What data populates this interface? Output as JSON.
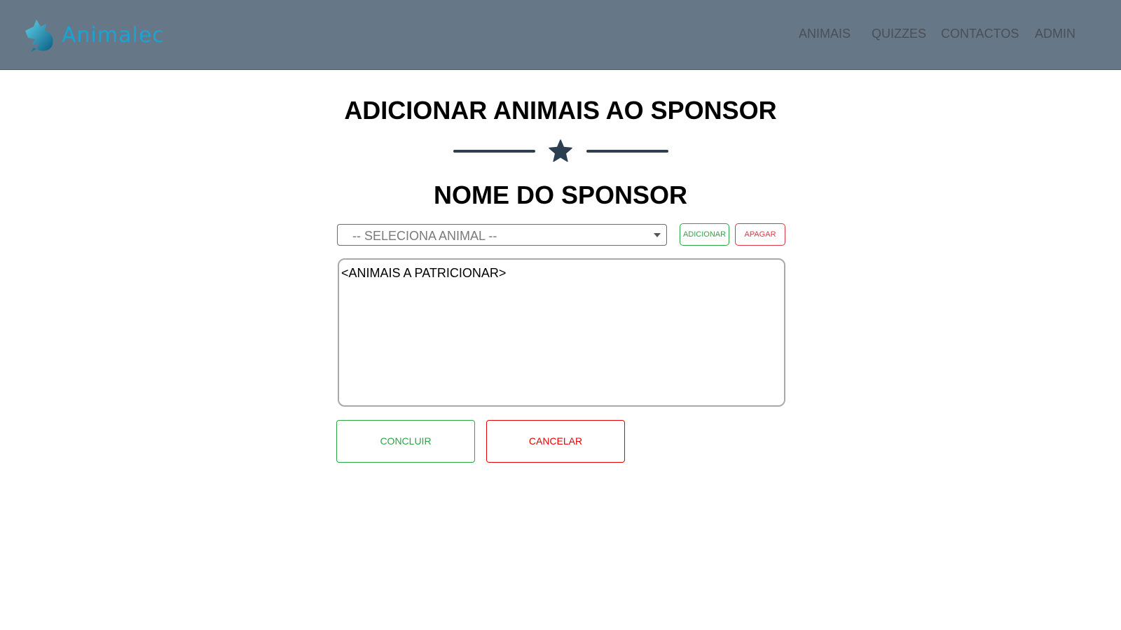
{
  "header": {
    "brand": "Animalec",
    "nav": [
      "ANIMAIS",
      "QUIZZES",
      "CONTACTOS",
      "ADMIN"
    ]
  },
  "main": {
    "title": "ADICIONAR ANIMAIS AO SPONSOR",
    "sponsor_name": "NOME DO SPONSOR",
    "select": {
      "selected": "-- SELECIONA ANIMAL --"
    },
    "add_button": "ADICIONAR",
    "delete_button": "APAGAR",
    "textarea_value": "<ANIMAIS A PATRICIONAR>",
    "confirm_button": "CONCLUIR",
    "cancel_button": "CANCELAR"
  },
  "icons": {
    "logo": "wolf-logo-icon",
    "divider": "star-icon",
    "select_arrow": "caret-down-icon"
  },
  "colors": {
    "navbar": "#667788",
    "brand": "#1ba3d4",
    "accent_dark": "#2c3e50",
    "success": "#28a745",
    "danger": "#dc3545"
  }
}
